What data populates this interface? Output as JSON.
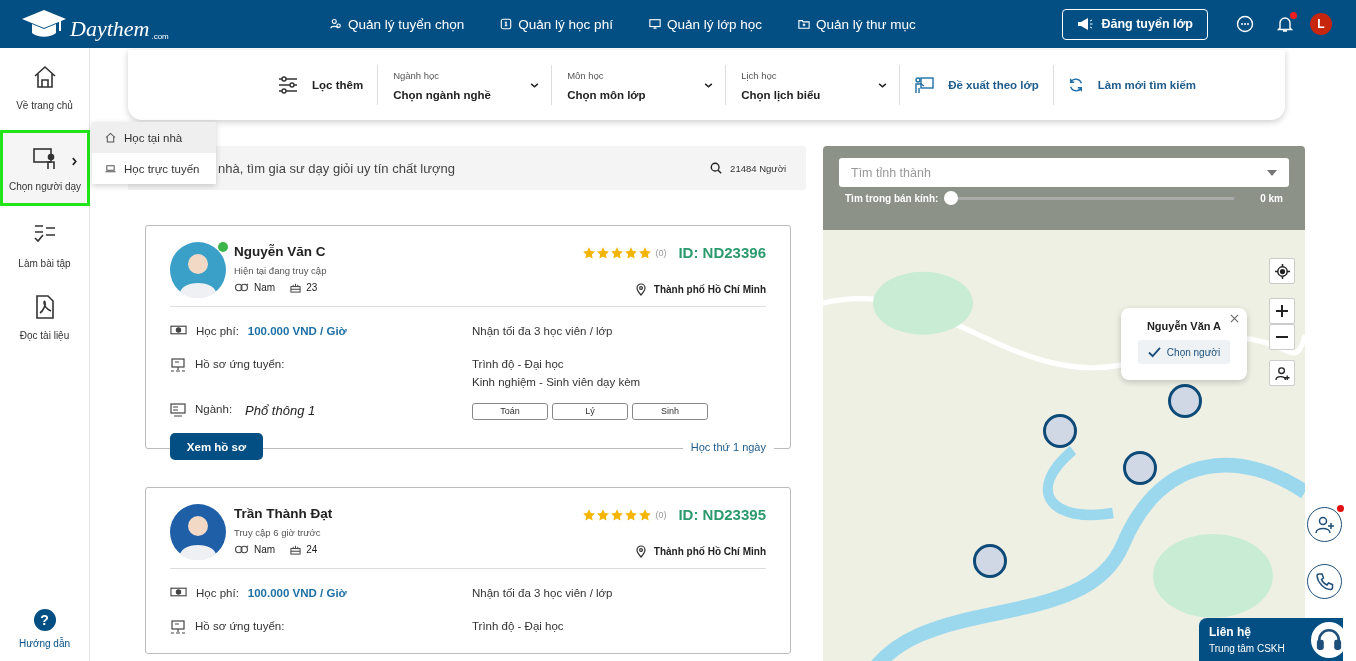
{
  "header": {
    "logo": "Daythem",
    "logo_suffix": ".com",
    "nav": [
      {
        "label": "Quản lý tuyển chọn"
      },
      {
        "label": "Quản lý học phí"
      },
      {
        "label": "Quản lý lớp học"
      },
      {
        "label": "Quản lý thư mục"
      }
    ],
    "post_button": "Đăng tuyển lớp",
    "notification_unread": true,
    "avatar": "L"
  },
  "sidebar": {
    "items": [
      {
        "label": "Về trang chủ",
        "selected": false
      },
      {
        "label": "Chọn người dạy",
        "selected": true
      },
      {
        "label": "Làm bài tập",
        "selected": false
      },
      {
        "label": "Đọc tài liệu",
        "selected": false
      }
    ],
    "help_icon": "?",
    "help": "Hướng dẫn"
  },
  "submenu": [
    {
      "label": "Học tại nhà",
      "selected": true
    },
    {
      "label": "Học trực tuyến",
      "selected": false
    }
  ],
  "filters": {
    "more": "Lọc thêm",
    "dropdowns": [
      {
        "label": "Ngành học",
        "value": "Chọn ngành nghề"
      },
      {
        "label": "Môn học",
        "value": "Chọn môn lớp"
      },
      {
        "label": "Lịch học",
        "value": "Chọn lịch biểu"
      }
    ],
    "suggest": "Đề xuất theo lớp",
    "reset": "Làm mới tìm kiếm"
  },
  "search": {
    "placeholder": "nhà, tìm gia sư dạy giỏi uy tín chất lượng",
    "count": "21484 Người"
  },
  "tutors": [
    {
      "name": "Nguyễn Văn C",
      "status": "Hiện tại đang truy cập",
      "online": true,
      "gender": "Nam",
      "age": "23",
      "stars": 5,
      "reviews": "(0)",
      "id": "ID: ND23396",
      "location": "Thành phố Hồ Chí Minh",
      "fee_label": "Học phí:",
      "fee": "100.000 VND / Giờ",
      "capacity": "Nhận tối đa 3 học viên / lớp",
      "profile_label": "Hồ sơ ứng tuyển:",
      "profile": [
        "Trình độ - Đại học",
        "Kinh nghiệm - Sinh viên dạy kèm"
      ],
      "major_label": "Ngành:",
      "major": "Phổ thông 1",
      "subjects": [
        "Toán",
        "Lý",
        "Sinh"
      ],
      "button": "Xem hồ sơ",
      "trial": "Học thứ 1 ngày"
    },
    {
      "name": "Trần Thành Đạt",
      "status": "Truy cập 6 giờ trước",
      "online": false,
      "gender": "Nam",
      "age": "24",
      "stars": 5,
      "reviews": "(0)",
      "id": "ID: ND23395",
      "location": "Thành phố Hồ Chí Minh",
      "fee_label": "Học phí:",
      "fee": "100.000 VND / Giờ",
      "capacity": "Nhận tối đa 3 học viên / lớp",
      "profile_label": "Hồ sơ ứng tuyển:",
      "profile": [
        "Trình độ - Đại học"
      ]
    }
  ],
  "map": {
    "province_placeholder": "Tìm tỉnh thành",
    "radius_label": "Tìm trong bán kính:",
    "radius": {
      "level": 0
    },
    "radius_value": "0 km",
    "popup": {
      "name": "Nguyễn Văn A",
      "button": "Chọn người"
    }
  },
  "floating": {
    "add_person_badge": true
  },
  "contact": {
    "title": "Liên hệ",
    "subtitle": "Trung tâm CSKH"
  }
}
